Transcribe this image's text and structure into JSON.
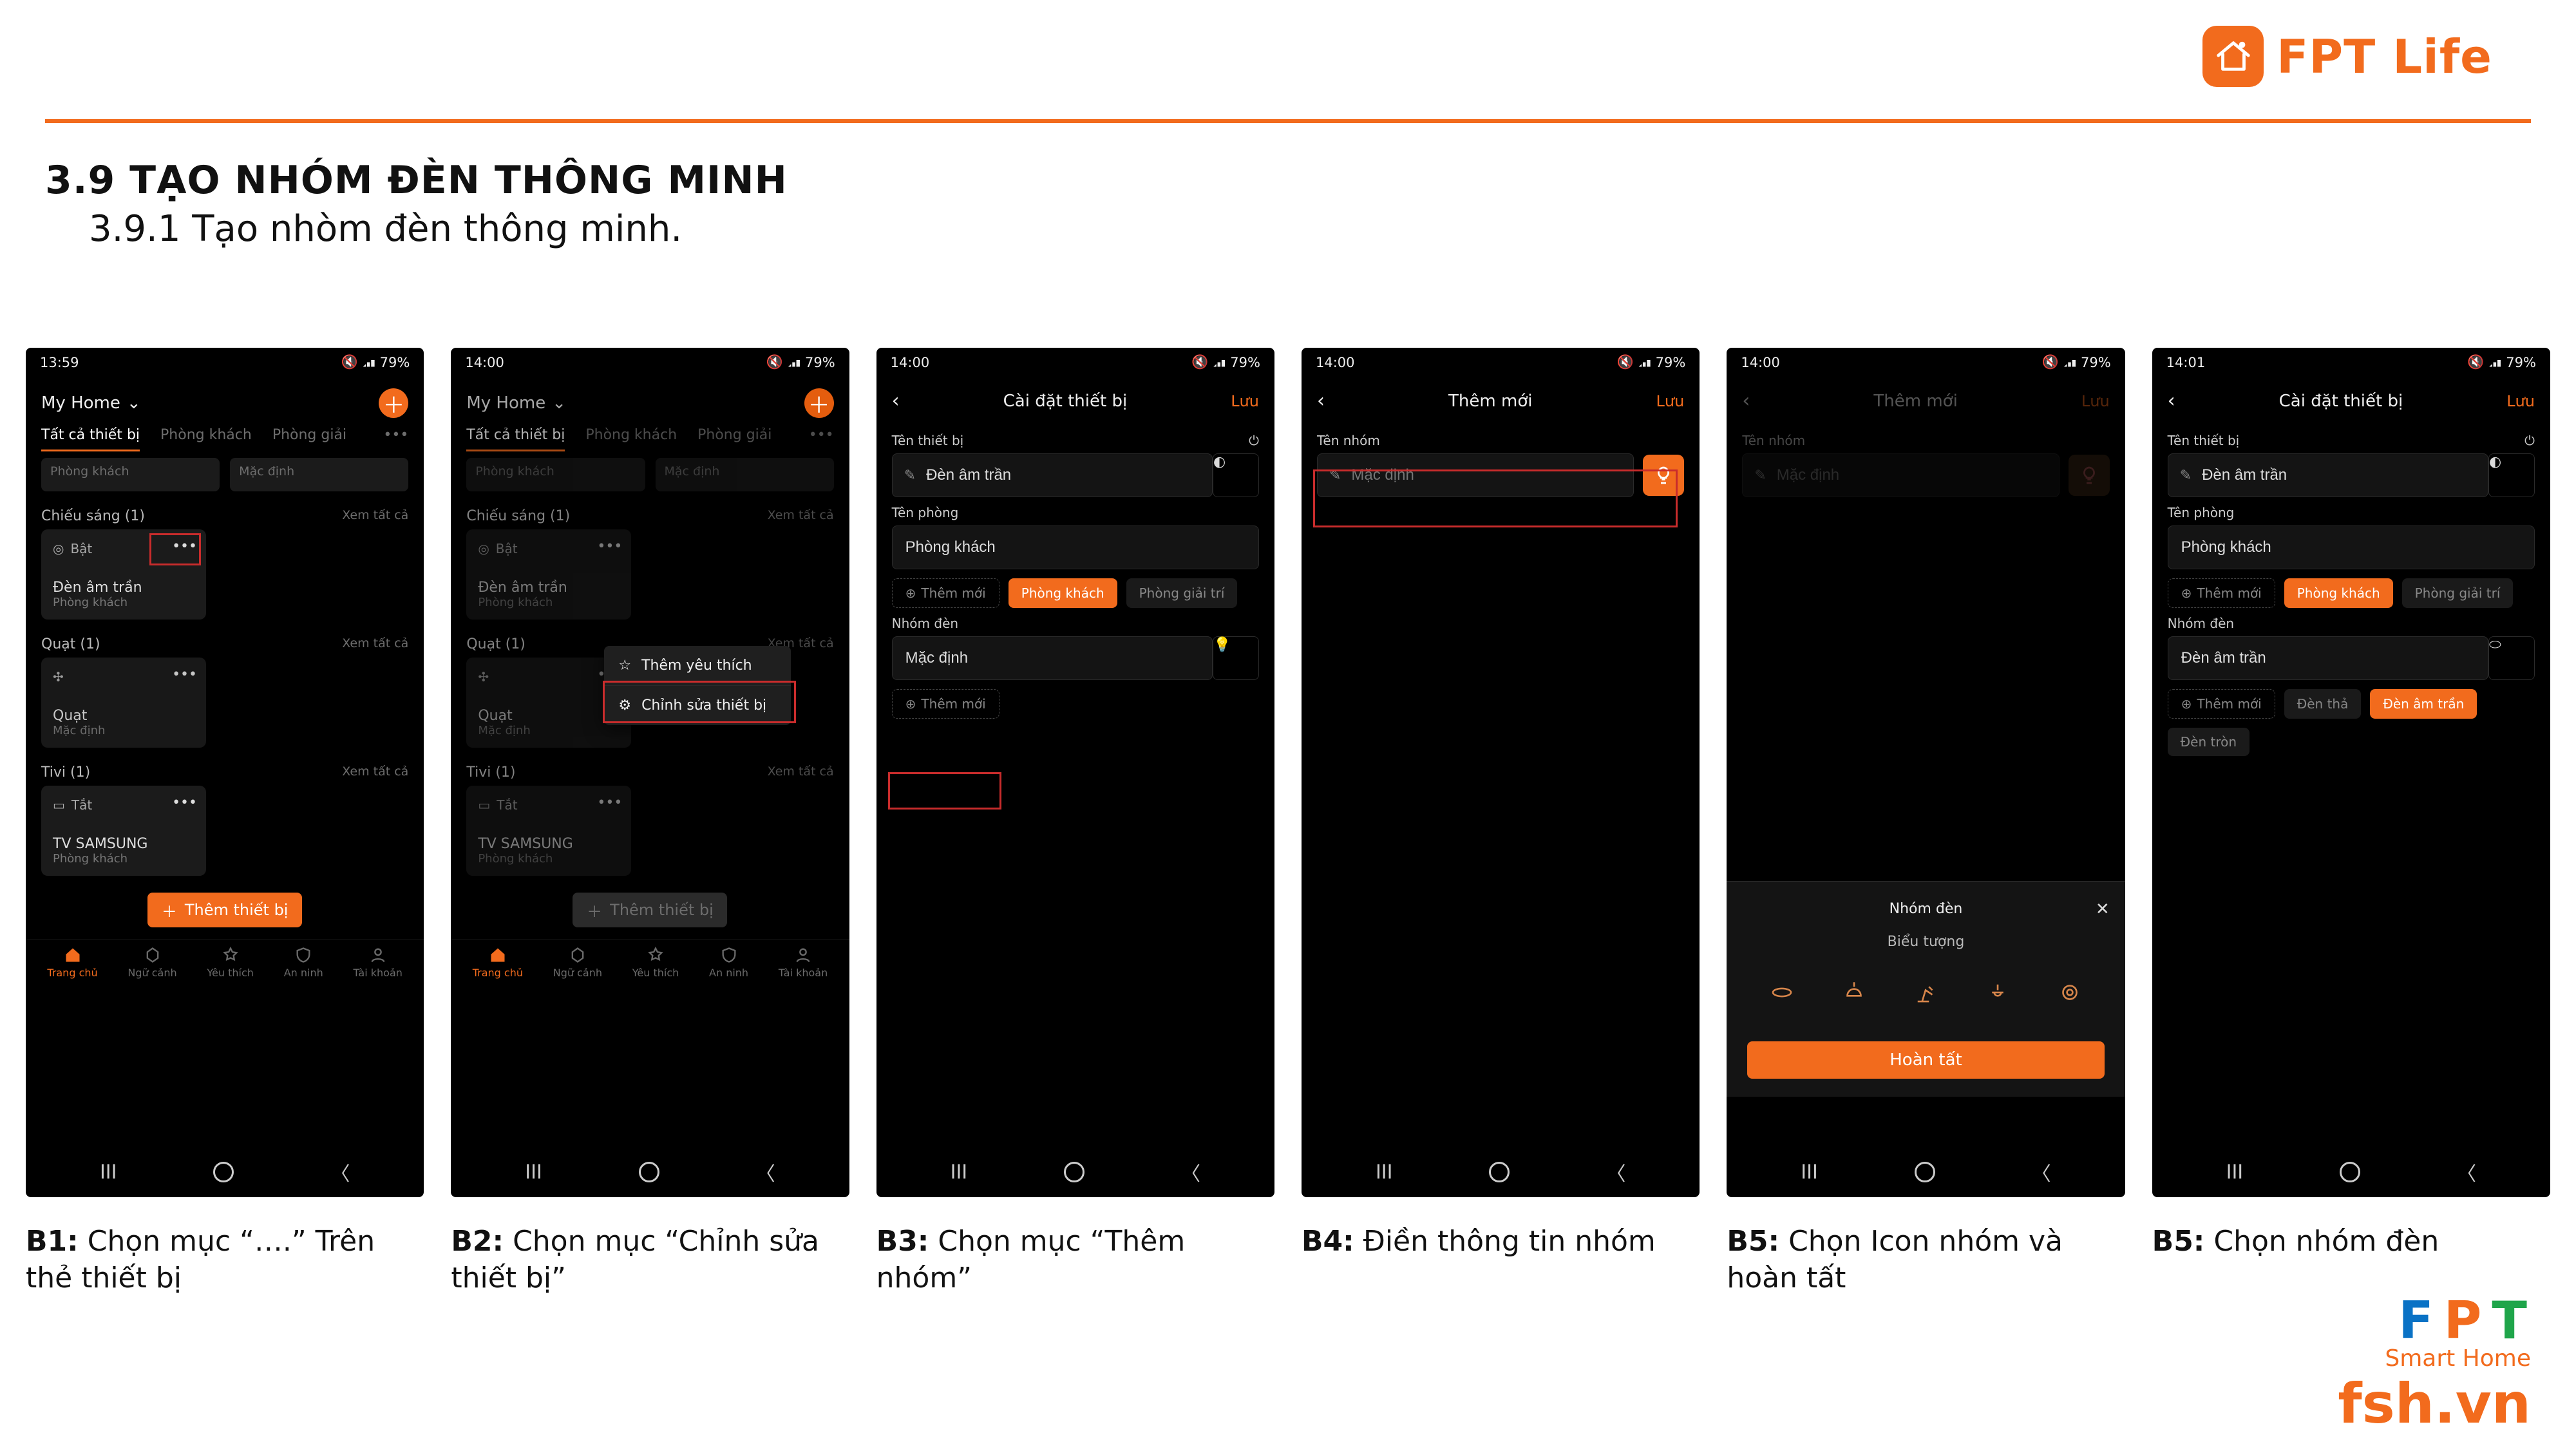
{
  "brand": {
    "name": "FPT Life"
  },
  "headings": {
    "h1": "3.9 TẠO NHÓM ĐÈN THÔNG MINH",
    "h2": "3.9.1 Tạo nhòm đèn thông minh."
  },
  "status": {
    "battery": "79%",
    "icons": "•  ⌂  ▼"
  },
  "screens": {
    "s1": {
      "time": "13:59",
      "home": "My Home",
      "tabs": [
        "Tất cả thiết bị",
        "Phòng khách",
        "Phòng giải"
      ],
      "mini": [
        "Phòng khách",
        "Mặc định"
      ],
      "sec1": "Chiếu sáng (1)",
      "all": "Xem tất cả",
      "dev1": {
        "state": "Bật",
        "name": "Đèn âm trần",
        "room": "Phòng khách"
      },
      "sec2": "Quạt (1)",
      "dev2": {
        "state": "",
        "name": "Quạt",
        "room": "Mặc định"
      },
      "sec3": "Tivi (1)",
      "dev3": {
        "state": "Tắt",
        "name": "TV SAMSUNG",
        "room": "Phòng khách"
      },
      "add": "Thêm thiết bị",
      "nav": [
        "Trang chủ",
        "Ngữ cảnh",
        "Yêu thích",
        "An ninh",
        "Tài khoản"
      ]
    },
    "s2": {
      "time": "14:00",
      "menu": [
        "Thêm yêu thích",
        "Chỉnh sửa thiết bị"
      ]
    },
    "s3": {
      "time": "14:00",
      "title": "Cài đặt thiết bị",
      "save": "Lưu",
      "f1_label": "Tên thiết bị",
      "f1_value": "Đèn âm trần",
      "f2_label": "Tên phòng",
      "f2_value": "Phòng khách",
      "room_chips": [
        "Thêm mới",
        "Phòng khách",
        "Phòng giải trí"
      ],
      "f3_label": "Nhóm đèn",
      "f3_value": "Mặc định",
      "add_group": "Thêm mới"
    },
    "s4": {
      "time": "14:00",
      "title": "Thêm mới",
      "save": "Lưu",
      "g_label": "Tên nhóm",
      "g_ph": "Mặc định"
    },
    "s5": {
      "time": "14:00",
      "title": "Thêm mới",
      "save": "Lưu",
      "g_label": "Tên nhóm",
      "g_ph": "Mặc định",
      "sheet_title": "Nhóm đèn",
      "sheet_sec": "Biểu tượng",
      "done": "Hoàn tất"
    },
    "s6": {
      "time": "14:01",
      "title": "Cài đặt thiết bị",
      "save": "Lưu",
      "f1_label": "Tên thiết bị",
      "f1_value": "Đèn âm trần",
      "f2_label": "Tên phòng",
      "f2_value": "Phòng khách",
      "room_chips": [
        "Thêm mới",
        "Phòng khách",
        "Phòng giải trí"
      ],
      "f3_label": "Nhóm đèn",
      "f3_value": "Đèn âm trần",
      "group_chips": [
        "Thêm mới",
        "Đèn thả",
        "Đèn âm trần",
        "Đèn tròn"
      ]
    }
  },
  "captions": [
    {
      "b": "B1:",
      "t": " Chọn mục “….” Trên thẻ thiết bị"
    },
    {
      "b": "B2:",
      "t": " Chọn mục “Chỉnh sửa thiết bị”"
    },
    {
      "b": "B3:",
      "t": " Chọn mục “Thêm nhóm”"
    },
    {
      "b": "B4:",
      "t": " Điền thông tin nhóm"
    },
    {
      "b": "B5:",
      "t": " Chọn Icon nhóm và hoàn tất"
    },
    {
      "b": "B5:",
      "t": " Chọn nhóm đèn"
    }
  ],
  "watermark": {
    "fpt": [
      "F",
      "P",
      "T"
    ],
    "sh": "Smart Home",
    "url": "fsh.vn"
  }
}
